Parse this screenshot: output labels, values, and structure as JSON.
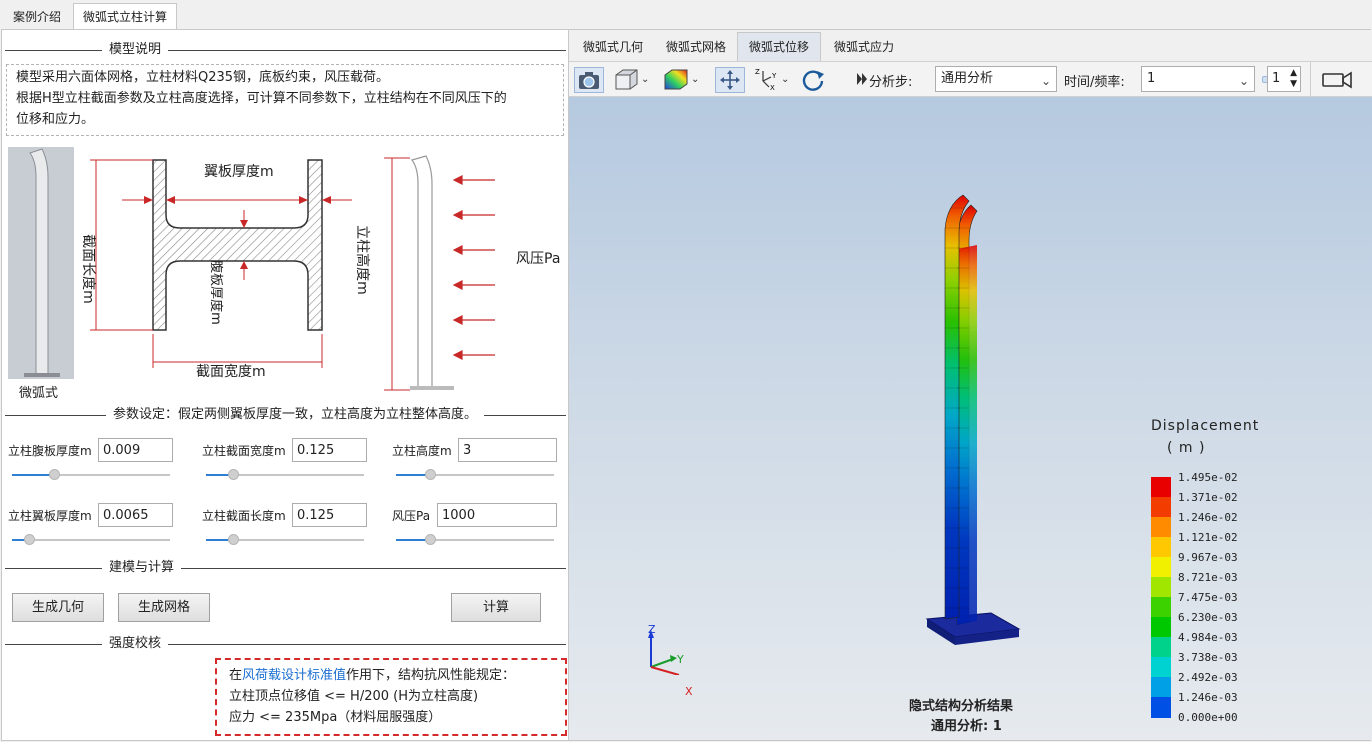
{
  "top_tabs": [
    {
      "label": "案例介绍",
      "active": false
    },
    {
      "label": "微弧式立柱计算",
      "active": true
    }
  ],
  "left": {
    "section_model": "模型说明",
    "description_lines": [
      "模型采用六面体网格，立柱材料Q235钢，底板约束，风压载荷。",
      "根据H型立柱截面参数及立柱高度选择，可计算不同参数下，立柱结构在不同风压下的",
      "位移和应力。"
    ],
    "figure": {
      "post_caption": "微弧式",
      "flange_thickness": "翼板厚度m",
      "section_length": "截面长度m",
      "web_thickness": "腹板厚度m",
      "section_width": "截面宽度m",
      "post_height": "立柱高度m",
      "wind_pressure": "风压Pa"
    },
    "section_params": "参数设定：假定两侧翼板厚度一致，立柱高度为立柱整体高度。",
    "params": [
      {
        "label": "立柱腹板厚度m",
        "value": "0.009",
        "slider": 0.25
      },
      {
        "label": "立柱截面宽度m",
        "value": "0.125",
        "slider": 0.15
      },
      {
        "label": "立柱高度m",
        "value": "3",
        "slider": 0.2
      },
      {
        "label": "立柱翼板厚度m",
        "value": "0.0065",
        "slider": 0.08
      },
      {
        "label": "立柱截面长度m",
        "value": "0.125",
        "slider": 0.15
      },
      {
        "label": "风压Pa",
        "value": "1000",
        "slider": 0.2
      }
    ],
    "section_build": "建模与计算",
    "buttons": {
      "geometry": "生成几何",
      "mesh": "生成网格",
      "compute": "计算"
    },
    "section_check": "强度校核",
    "check": {
      "pre": "在",
      "link": "风荷载设计标准值",
      "post": "作用下，结构抗风性能规定：",
      "line2": "立柱顶点位移值 <= H/200 (H为立柱高度)",
      "line3": "应力 <= 235Mpa（材料屈服强度）"
    }
  },
  "right": {
    "sub_tabs": [
      {
        "label": "微弧式几何",
        "active": false
      },
      {
        "label": "微弧式网格",
        "active": false
      },
      {
        "label": "微弧式位移",
        "active": true
      },
      {
        "label": "微弧式应力",
        "active": false
      }
    ],
    "toolbar": {
      "step_label": "分析步:",
      "step_value": "通用分析",
      "time_label": "时间/频率:",
      "time_value": "1",
      "spin_value": "1"
    },
    "icons": [
      "camera-icon",
      "cube-view-icon",
      "color-map-icon",
      "fit-view-icon",
      "axes-orientation-icon",
      "rotate-icon",
      "animation-icon",
      "video-camera-icon"
    ],
    "legend": {
      "title": "Displacement",
      "unit": "( m )",
      "labels": [
        "1.495e-02",
        "1.371e-02",
        "1.246e-02",
        "1.121e-02",
        "9.967e-03",
        "8.721e-03",
        "7.475e-03",
        "6.230e-03",
        "4.984e-03",
        "3.738e-03",
        "2.492e-03",
        "1.246e-03",
        "0.000e+00"
      ],
      "colors": [
        "#e80000",
        "#f23c00",
        "#ff8c00",
        "#ffc800",
        "#f0f000",
        "#a0e600",
        "#3cd200",
        "#00c800",
        "#00d28c",
        "#00d2d2",
        "#00a0e6",
        "#0050e6",
        "#0000c8"
      ]
    },
    "axes": {
      "x": "X",
      "y": "Y",
      "z": "Z"
    },
    "caption": {
      "line1": "隐式结构分析结果",
      "line2": "通用分析: 1"
    }
  }
}
